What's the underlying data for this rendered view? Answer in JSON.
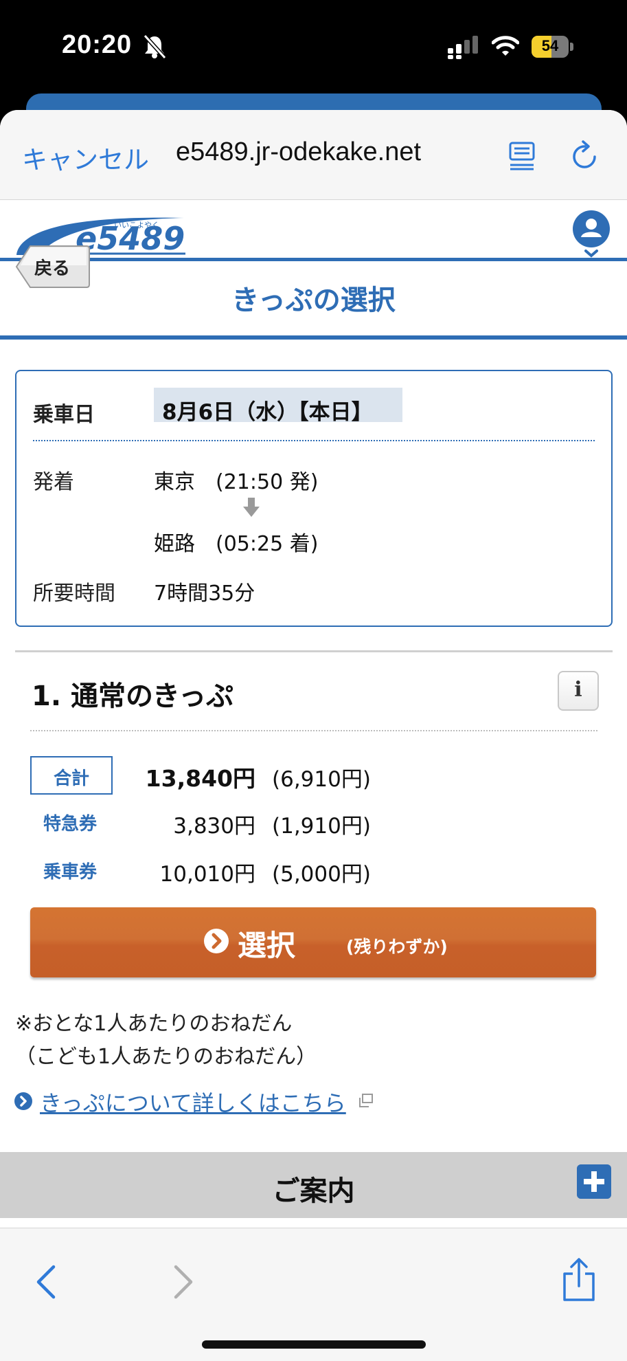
{
  "status_bar": {
    "time": "20:20",
    "battery": "54",
    "battery_level": 0.54
  },
  "browser": {
    "cancel_label": "キャンセル",
    "url": "e5489.jr-odekake.net"
  },
  "site": {
    "logo_text": "e5489",
    "logo_furigana": "いいこよやく"
  },
  "page": {
    "back_label": "戻る",
    "title": "きっぷの選択"
  },
  "trip": {
    "date_label": "乗車日",
    "date_value": "8月6日（水）【本日】",
    "depart_label": "発着",
    "depart_value": "東京　(21:50 発)",
    "arrive_value": "姫路　(05:25 着)",
    "duration_label": "所要時間",
    "duration_value": "7時間35分"
  },
  "ticket": {
    "section_title": "1. 通常のきっぷ",
    "info_label": "i",
    "prices": [
      {
        "label": "合計",
        "amount": "13,840円",
        "child": "(6,910円)"
      },
      {
        "label": "特急券",
        "amount": "3,830円",
        "child": "(1,910円)"
      },
      {
        "label": "乗車券",
        "amount": "10,010円",
        "child": "(5,000円)"
      }
    ],
    "select_label": "選択",
    "select_sub": "(残りわずか)",
    "note_line1": "※おとな1人あたりのおねだん",
    "note_line2": "（こども1人あたりのおねだん）",
    "details_link": "きっぷについて詳しくはこちら"
  },
  "guide": {
    "title": "ご案内"
  },
  "colors": {
    "brand_blue": "#2e6db5",
    "ios_blue": "#2f7ad8",
    "select_orange": "#cd6a30"
  }
}
